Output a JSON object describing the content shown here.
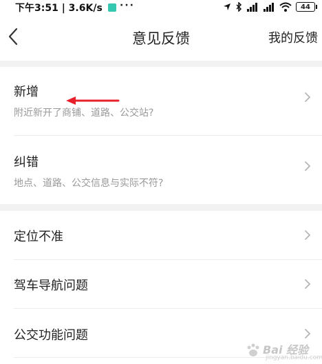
{
  "status_bar": {
    "time_speed": "下午3:51 | 3.6K/s",
    "dots": "···",
    "battery": "44"
  },
  "nav": {
    "title": "意见反馈",
    "right_link": "我的反馈"
  },
  "groups": [
    {
      "items": [
        {
          "title": "新增",
          "subtitle": "附近新开了商铺、道路、公交站?"
        },
        {
          "title": "纠错",
          "subtitle": "地点、道路、公交信息与实际不符?"
        }
      ]
    },
    {
      "items": [
        {
          "title": "定位不准"
        },
        {
          "title": "驾车导航问题"
        },
        {
          "title": "公交功能问题"
        }
      ]
    }
  ],
  "annotation": {
    "arrow_color": "#e8202a"
  },
  "watermark": {
    "text": "Bai 经验",
    "sub": "jingyan.baidu.com"
  },
  "colors": {
    "separator": "#f2f2f2",
    "subtitle": "#999999",
    "chevron": "#b5b5b5"
  }
}
